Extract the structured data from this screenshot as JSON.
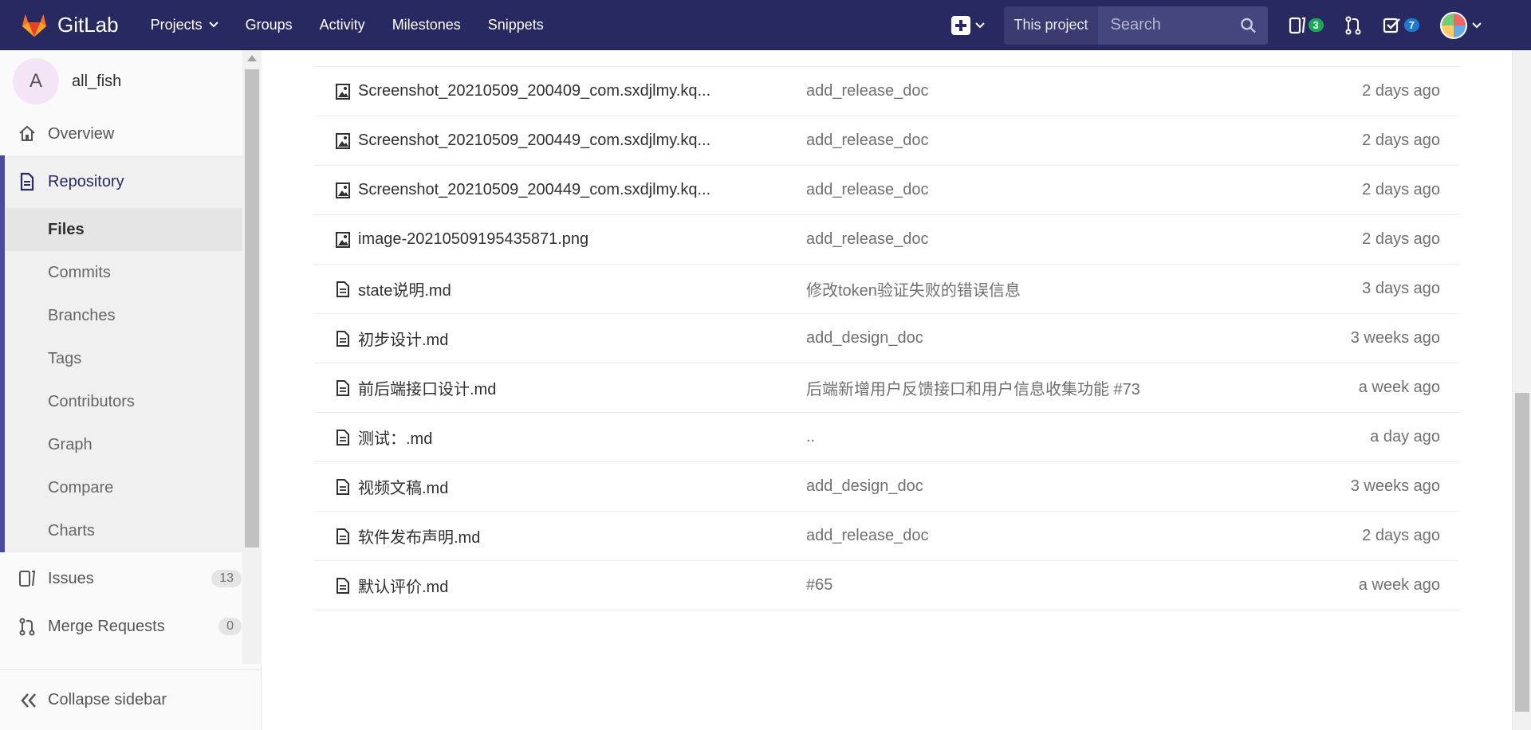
{
  "navbar": {
    "brand": "GitLab",
    "links": [
      {
        "label": "Projects",
        "dropdown": true
      },
      {
        "label": "Groups"
      },
      {
        "label": "Activity"
      },
      {
        "label": "Milestones"
      },
      {
        "label": "Snippets"
      }
    ],
    "search_scope": "This project",
    "search_placeholder": "Search",
    "issues_count": "3",
    "todos_count": "7",
    "accent": "#292961"
  },
  "sidebar": {
    "project_initial": "A",
    "project_name": "all_fish",
    "overview": "Overview",
    "repository": "Repository",
    "repo_items": [
      "Files",
      "Commits",
      "Branches",
      "Tags",
      "Contributors",
      "Graph",
      "Compare",
      "Charts"
    ],
    "active_repo_item": "Files",
    "issues": {
      "label": "Issues",
      "count": "13"
    },
    "merge_requests": {
      "label": "Merge Requests",
      "count": "0"
    },
    "collapse": "Collapse sidebar"
  },
  "files": [
    {
      "name": "Screenshot_20210509_200409_com.sxdjlmy.kq...",
      "icon": "image-file-icon",
      "commit": "add_release_doc",
      "time": "2 days ago"
    },
    {
      "name": "Screenshot_20210509_200449_com.sxdjlmy.kq...",
      "icon": "image-file-icon",
      "commit": "add_release_doc",
      "time": "2 days ago"
    },
    {
      "name": "Screenshot_20210509_200449_com.sxdjlmy.kq...",
      "icon": "image-file-icon",
      "commit": "add_release_doc",
      "time": "2 days ago"
    },
    {
      "name": "image-20210509195435871.png",
      "icon": "image-file-icon",
      "commit": "add_release_doc",
      "time": "2 days ago"
    },
    {
      "name": "state说明.md",
      "icon": "text-file-icon",
      "commit": "修改token验证失败的错误信息",
      "time": "3 days ago"
    },
    {
      "name": "初步设计.md",
      "icon": "text-file-icon",
      "commit": "add_design_doc",
      "time": "3 weeks ago"
    },
    {
      "name": "前后端接口设计.md",
      "icon": "text-file-icon",
      "commit": "后端新增用户反馈接口和用户信息收集功能 #73",
      "time": "a week ago"
    },
    {
      "name": "测试：.md",
      "icon": "text-file-icon",
      "commit": "..",
      "time": "a day ago"
    },
    {
      "name": "视频文稿.md",
      "icon": "text-file-icon",
      "commit": "add_design_doc",
      "time": "3 weeks ago"
    },
    {
      "name": "软件发布声明.md",
      "icon": "text-file-icon",
      "commit": "add_release_doc",
      "time": "2 days ago"
    },
    {
      "name": "默认评价.md",
      "icon": "text-file-icon",
      "commit": "#65",
      "time": "a week ago"
    }
  ]
}
